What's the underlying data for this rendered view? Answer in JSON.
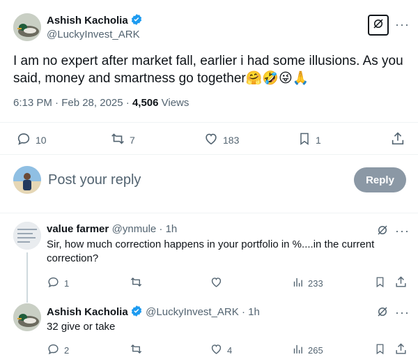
{
  "main_tweet": {
    "author_name": "Ashish Kacholia",
    "author_handle": "@LuckyInvest_ARK",
    "text": "I am no expert after market fall, earlier i had some illusions. As you said, money and smartness go together🤗🤣😜🙏",
    "timestamp": "6:13 PM · Feb 28, 2025 · ",
    "views_count": "4,506",
    "views_label": " Views",
    "replies": "10",
    "reposts": "7",
    "likes": "183",
    "bookmarks": "1"
  },
  "composer": {
    "placeholder": "Post your reply",
    "reply_label": "Reply"
  },
  "replies": [
    {
      "author_name": "value farmer",
      "author_handle": "@ynmule · 1h",
      "text_line1": "Sir, how much correction happens in your portfolio in %....in the current",
      "text_line2": "correction?",
      "replies": "1",
      "reposts": "",
      "likes": "",
      "views": "233"
    },
    {
      "author_name": "Ashish Kacholia",
      "author_handle": "@LuckyInvest_ARK · 1h",
      "text_line1": "32 give or take",
      "replies": "2",
      "reposts": "",
      "likes": "4",
      "views": "265"
    }
  ],
  "colors": {
    "text": "#0f1419",
    "muted": "#536471",
    "verified": "#1d9bf0",
    "divider": "#eff3f4",
    "reply_button": "#8b98a5"
  }
}
